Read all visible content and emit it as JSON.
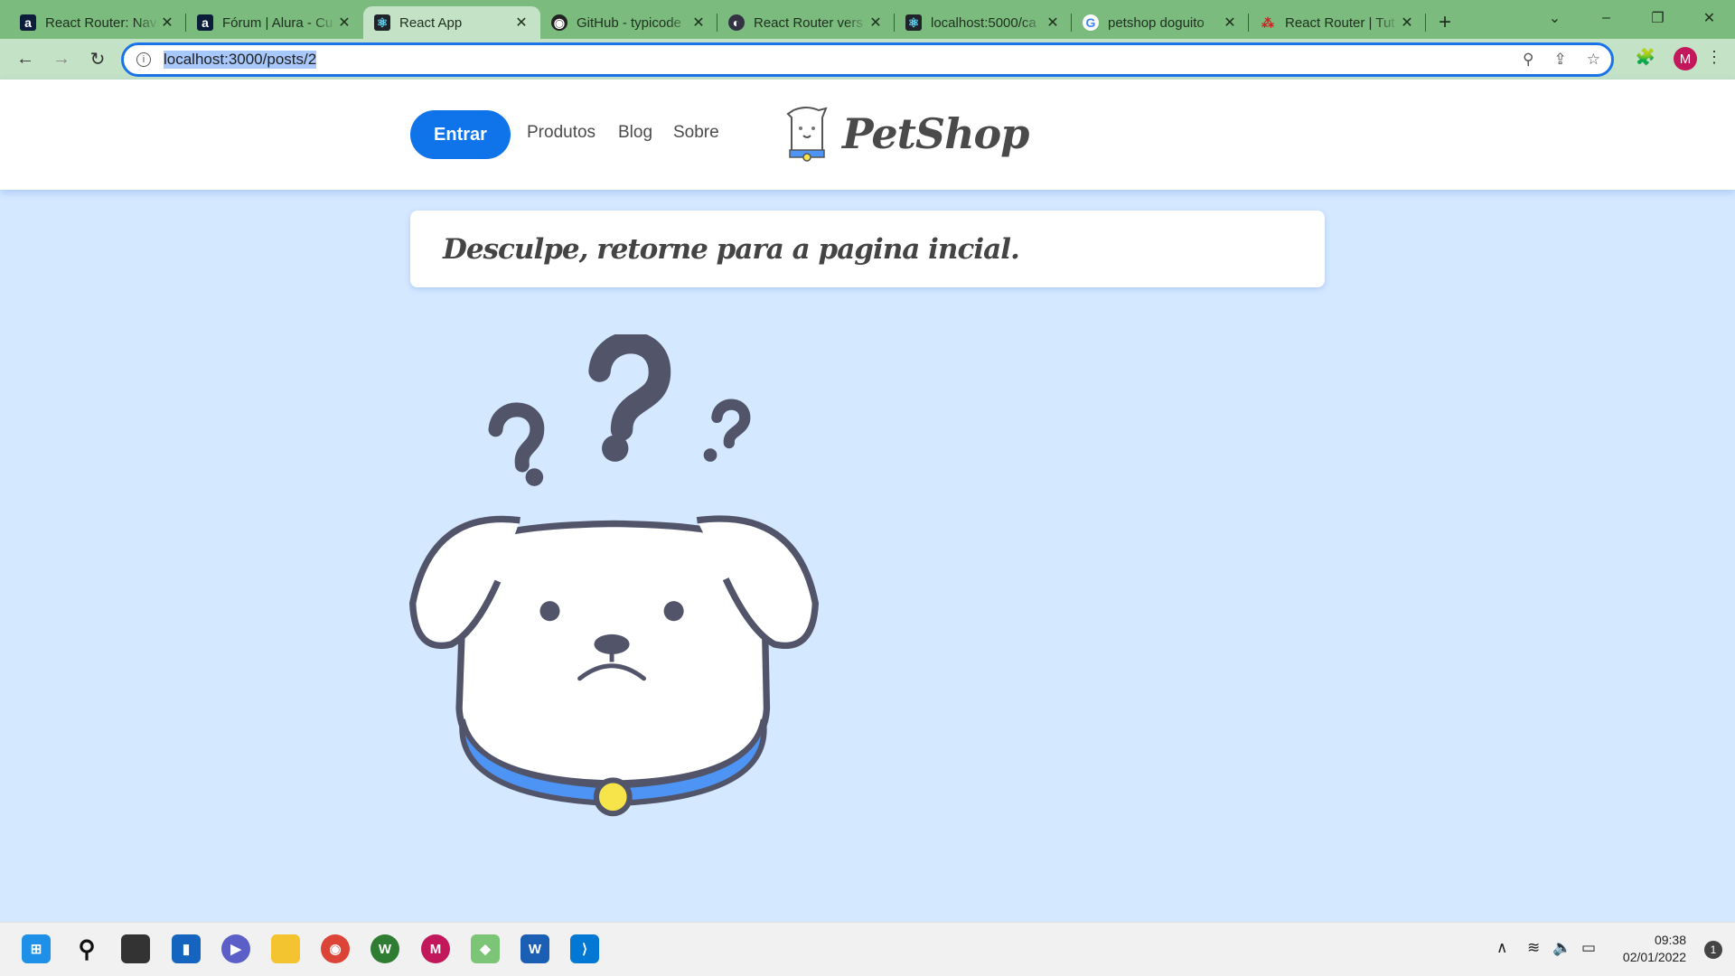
{
  "browser": {
    "tabs": [
      {
        "title": "React Router: Nav",
        "icon": "alura-icon"
      },
      {
        "title": "Fórum | Alura - Cu",
        "icon": "alura-icon"
      },
      {
        "title": "React App",
        "icon": "react-icon",
        "active": true
      },
      {
        "title": "GitHub - typicode",
        "icon": "github-icon"
      },
      {
        "title": "React Router vers",
        "icon": "react-router-icon"
      },
      {
        "title": "localhost:5000/ca",
        "icon": "react-icon"
      },
      {
        "title": "petshop doguito",
        "icon": "google-icon"
      },
      {
        "title": "React Router | Tut",
        "icon": "react-router-icon"
      }
    ],
    "url": "localhost:3000/posts/2",
    "profile_initial": "M",
    "accent": "#1a73e8",
    "frame_color": "#7bbb7e"
  },
  "header": {
    "login_button": "Entrar",
    "nav": [
      "Produtos",
      "Blog",
      "Sobre"
    ],
    "brand": "PetShop",
    "primary_color": "#0f73ea"
  },
  "main": {
    "message": "Desculpe, retorne para a pagina incial.",
    "illustration": "sad-dog-with-question-marks"
  },
  "taskbar": {
    "time": "09:38",
    "date": "02/01/2022",
    "notifications": "1"
  }
}
